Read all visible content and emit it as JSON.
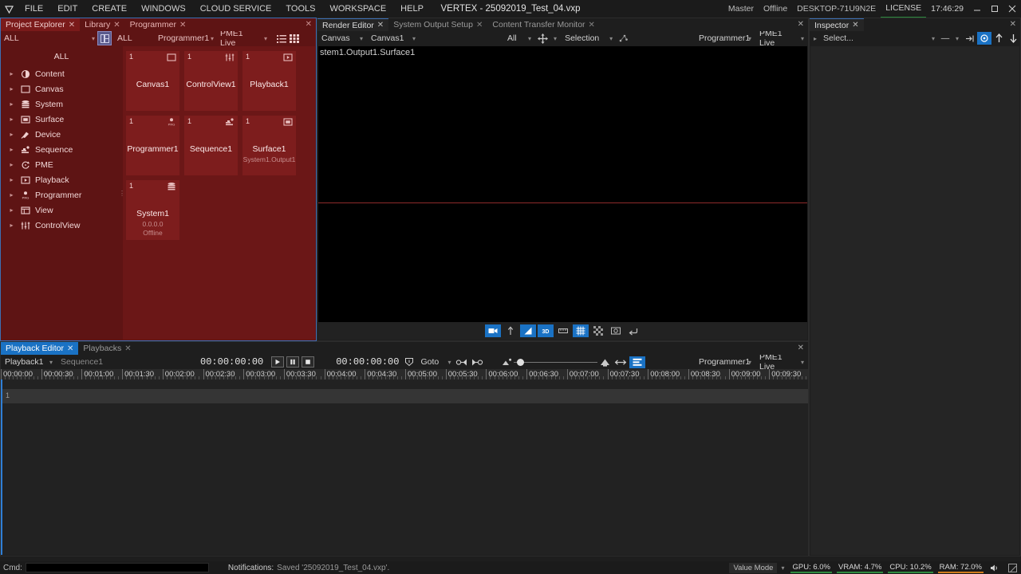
{
  "titlebar": {
    "logo_icon": "vertex-logo-icon",
    "menus": [
      "FILE",
      "EDIT",
      "CREATE",
      "WINDOWS",
      "CLOUD SERVICE",
      "TOOLS",
      "WORKSPACE",
      "HELP"
    ],
    "title": "VERTEX - 25092019_Test_04.vxp",
    "master": "Master",
    "status": "Offline",
    "machine": "DESKTOP-71U9N2E",
    "license": "LICENSE",
    "time": "17:46:29",
    "minimize_icon": "minimize-icon",
    "maximize_icon": "maximize-icon",
    "close_icon": "close-icon"
  },
  "project_explorer": {
    "tabs": [
      {
        "label": "Project Explorer",
        "active": true
      },
      {
        "label": "Library",
        "active": false
      },
      {
        "label": "Programmer",
        "active": false
      }
    ],
    "toolbar": {
      "filter": "ALL",
      "layout_icon": "layout-toggle-icon",
      "all_label": "ALL",
      "programmer": "Programmer1",
      "pme": "PME1 Live",
      "list_view_icon": "list-view-icon",
      "grid_view_icon": "grid-view-icon"
    },
    "tree": {
      "all_label": "ALL",
      "items": [
        {
          "label": "Content",
          "icon": "content-icon"
        },
        {
          "label": "Canvas",
          "icon": "canvas-icon"
        },
        {
          "label": "System",
          "icon": "system-icon"
        },
        {
          "label": "Surface",
          "icon": "surface-icon"
        },
        {
          "label": "Device",
          "icon": "device-icon"
        },
        {
          "label": "Sequence",
          "icon": "sequence-icon"
        },
        {
          "label": "PME",
          "icon": "pme-icon"
        },
        {
          "label": "Playback",
          "icon": "playback-icon"
        },
        {
          "label": "Programmer",
          "icon": "programmer-icon"
        },
        {
          "label": "View",
          "icon": "view-icon"
        },
        {
          "label": "ControlView",
          "icon": "controlview-icon"
        }
      ]
    },
    "cards": [
      {
        "num": "1",
        "name": "Canvas1",
        "sub": "",
        "icon": "canvas-icon"
      },
      {
        "num": "1",
        "name": "ControlView1",
        "sub": "",
        "icon": "controlview-icon"
      },
      {
        "num": "1",
        "name": "Playback1",
        "sub": "",
        "icon": "playback-icon"
      },
      {
        "num": "1",
        "name": "Programmer1",
        "sub": "",
        "icon": "programmer-icon"
      },
      {
        "num": "1",
        "name": "Sequence1",
        "sub": "",
        "icon": "sequence-icon"
      },
      {
        "num": "1",
        "name": "Surface1",
        "sub": "System1.Output1",
        "icon": "surface-icon"
      },
      {
        "num": "1",
        "name": "System1",
        "sub": "0.0.0.0\nOffline",
        "icon": "system-icon"
      }
    ]
  },
  "render_editor": {
    "tabs": [
      {
        "label": "Render Editor",
        "active": true
      },
      {
        "label": "System Output Setup",
        "active": false
      },
      {
        "label": "Content Transfer Monitor",
        "active": false
      }
    ],
    "toolbar": {
      "type": "Canvas",
      "target": "Canvas1",
      "filter": "All",
      "move_icon": "move-gizmo-icon",
      "mode": "Selection",
      "snap_icon": "snap-points-icon",
      "programmer": "Programmer1",
      "pme": "PME1 Live"
    },
    "viewport_label": "stem1.Output1.Surface1",
    "viewport_toolbar": [
      {
        "icon": "camera-icon",
        "on": true
      },
      {
        "icon": "normals-icon",
        "on": false
      },
      {
        "icon": "shading-icon",
        "on": true
      },
      {
        "icon": "3d-icon",
        "on": true
      },
      {
        "icon": "ruler-icon",
        "on": false
      },
      {
        "icon": "grid-icon",
        "on": true
      },
      {
        "icon": "checker-icon",
        "on": false
      },
      {
        "icon": "snapshot-icon",
        "on": false
      },
      {
        "icon": "reset-icon",
        "on": false
      }
    ]
  },
  "inspector": {
    "tabs": [
      {
        "label": "Inspector",
        "active": true
      }
    ],
    "toolbar": {
      "select_value": "Select...",
      "dash_value": "—",
      "pin_icon": "pin-icon",
      "target-icon": "target-icon",
      "up_icon": "arrow-up-icon",
      "down_icon": "arrow-down-icon"
    }
  },
  "playback_editor": {
    "tabs": [
      {
        "label": "Playback Editor",
        "active": true
      },
      {
        "label": "Playbacks",
        "active": false
      }
    ],
    "toolbar": {
      "playback": "Playback1",
      "sequence": "Sequence1",
      "timecode_left": "00:00:00:00",
      "play_icon": "play-icon",
      "pause_icon": "pause-icon",
      "stop_icon": "stop-icon",
      "timecode_right": "00:00:00:00",
      "goto_icon": "goto-badge-icon",
      "goto_label": "Goto",
      "prev_cue_icon": "prev-cue-icon",
      "next_cue_icon": "next-cue-icon",
      "zoom_out_icon": "zoom-out-icon",
      "zoom_in_icon": "zoom-in-icon",
      "fit_icon": "fit-horizontal-icon",
      "layers_icon": "layers-icon",
      "programmer": "Programmer1",
      "pme": "PME1 Live",
      "zoom_slider_value": 10
    },
    "ruler_ticks": [
      "00:00:00",
      "00:00:30",
      "00:01:00",
      "00:01:30",
      "00:02:00",
      "00:02:30",
      "00:03:00",
      "00:03:30",
      "00:04:00",
      "00:04:30",
      "00:05:00",
      "00:05:30",
      "00:06:00",
      "00:06:30",
      "00:07:00",
      "00:07:30",
      "00:08:00",
      "00:08:30",
      "00:09:00",
      "00:09:30"
    ],
    "tracks": [
      {
        "num": "1"
      }
    ]
  },
  "statusbar": {
    "cmd_label": "Cmd:",
    "cmd_value": "",
    "notifications_label": "Notifications:",
    "notification": "Saved '25092019_Test_04.vxp'.",
    "value_mode": "Value Mode",
    "meters": [
      {
        "label": "GPU: 6.0%",
        "pct": 6,
        "color": "#2d8a3e"
      },
      {
        "label": "VRAM: 4.7%",
        "pct": 4.7,
        "color": "#2d8a3e"
      },
      {
        "label": "CPU: 10.2%",
        "pct": 10.2,
        "color": "#2d8a3e"
      },
      {
        "label": "RAM: 72.0%",
        "pct": 72,
        "color": "#d07b1a"
      }
    ],
    "speaker_icon": "speaker-icon",
    "resize_icon": "resize-grip-icon"
  },
  "colors": {
    "accent_blue": "#1a72c4",
    "panel_red": "#5e1414",
    "card_red": "#7d1d1d",
    "dark_bg": "#1e1e1e"
  }
}
